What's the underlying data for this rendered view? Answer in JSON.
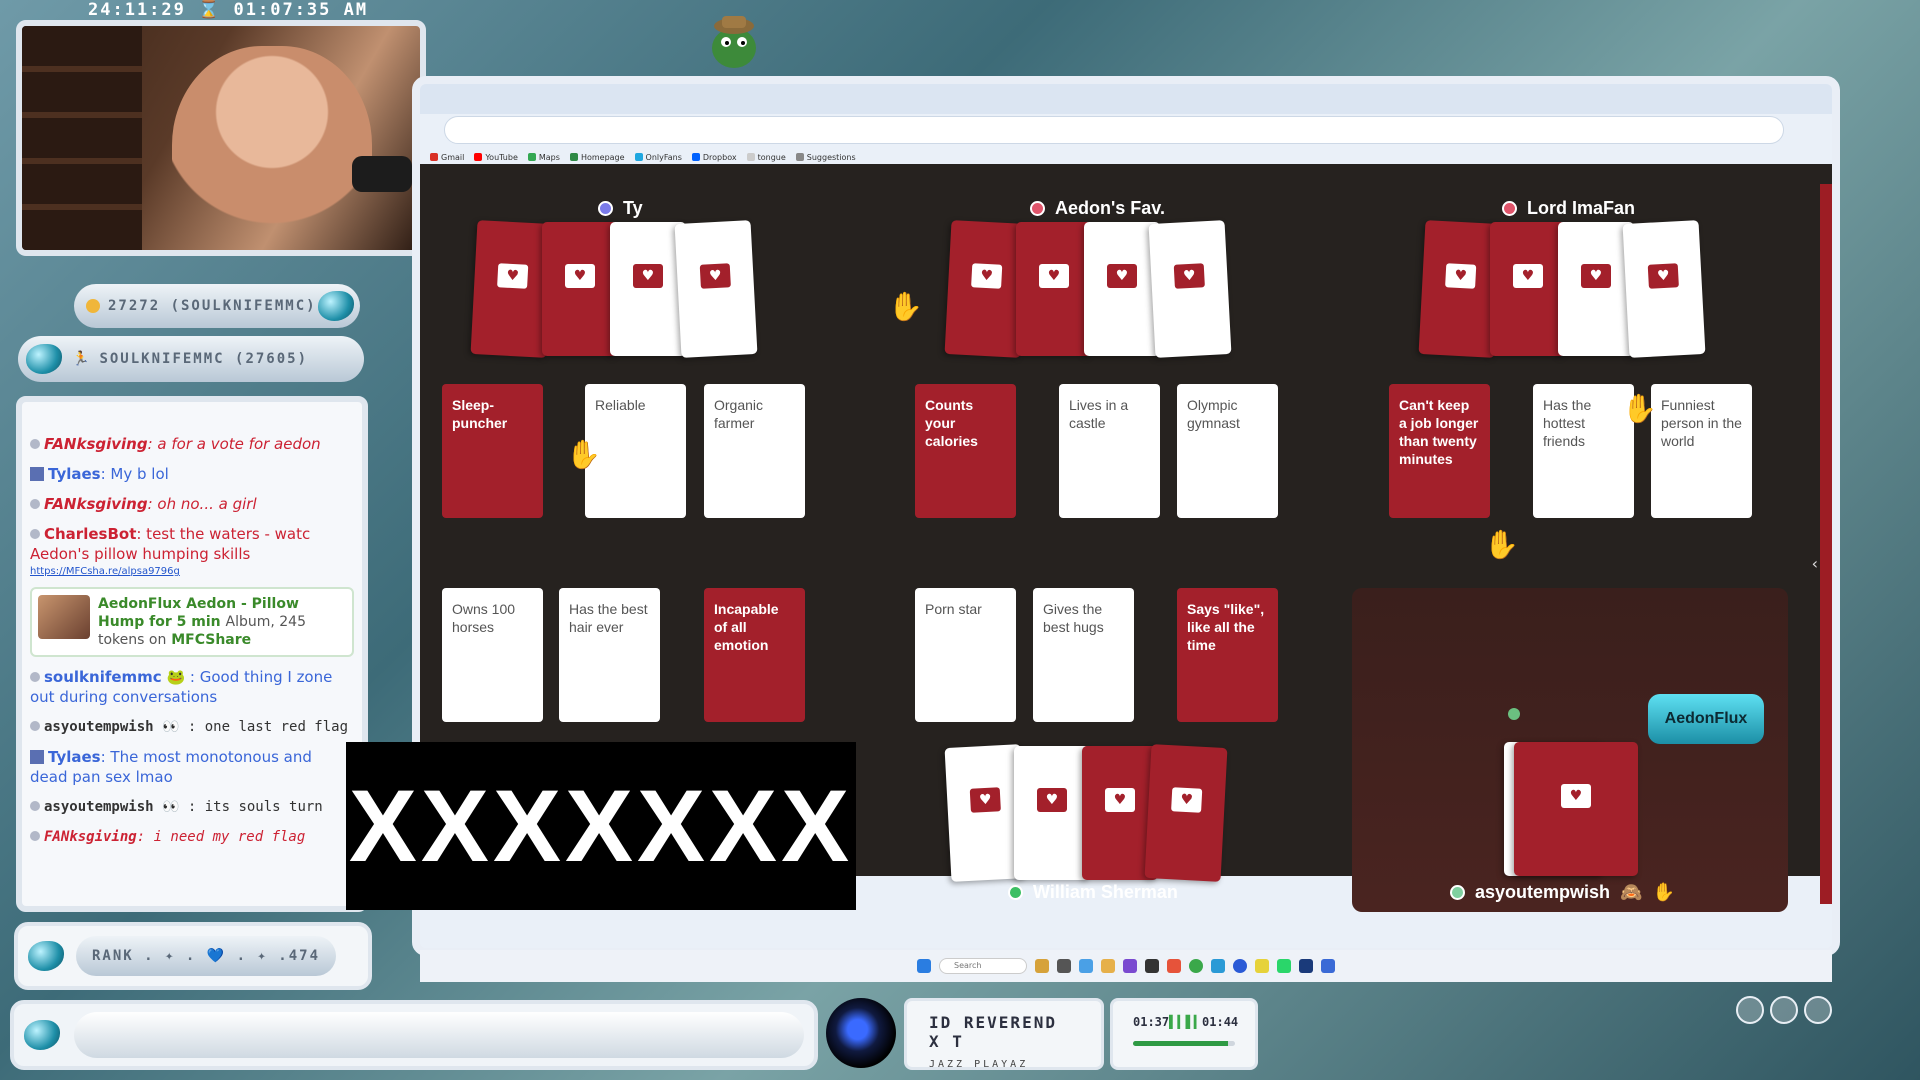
{
  "overlay": {
    "timestamp": "24:11:29 ⌛ 01:07:35 AM",
    "tip_top": "27272 (SOULKNIFEMMC)",
    "tip_top_leader": "SOULKNIFEMMC (27605)",
    "rank_text": "RANK . ✦ . 💙 . ✦ .474",
    "censor_text": "XXXXXXX",
    "logo_text": "AedonFlux"
  },
  "chat": {
    "messages": [
      {
        "user": "FANksgiving",
        "text": ": a  for  a vote for aedon",
        "color": "#cc2233"
      },
      {
        "user": "Tylaes",
        "text": ": My b lol",
        "color": "#3a66d8"
      },
      {
        "user": "FANksgiving",
        "text": ": oh no... a  girl",
        "color": "#cc2233"
      },
      {
        "user": "CharlesBot",
        "text": ": test the waters - watc Aedon's pillow humping skills",
        "color": "#cc2233"
      },
      {
        "user": "soulknifemmc",
        "text": "🐸 : Good thing I zone out during conversations",
        "color": "#3a66d8"
      },
      {
        "user": "asyoutempwish",
        "text": "👀 : one last red flag",
        "color": "#333333"
      },
      {
        "user": "Tylaes",
        "text": ": The most monotonous and dead pan sex lmao",
        "color": "#3a66d8"
      },
      {
        "user": "asyoutempwish",
        "text": "👀 : its souls turn",
        "color": "#333333"
      },
      {
        "user": "FANksgiving",
        "text": ": i need my red flag",
        "color": "#cc2233"
      }
    ],
    "link": "https://MFCsha.re/alpsa9796g",
    "mfc_card": {
      "title": "AedonFlux Aedon - Pillow Hump for 5 min",
      "meta": "Album, 245 tokens on",
      "brand": "MFCShare"
    }
  },
  "music": {
    "title": "ID REVEREND X T",
    "artist": "JAZZ PLAYAZ",
    "elapsed": "01:37",
    "total": "01:44",
    "progress": 0.93
  },
  "browser": {
    "bookmarks": [
      "Gmail",
      "YouTube",
      "Maps",
      "Homepage",
      "OnlyFans",
      "Dropbox",
      "tongue",
      "Suggestions"
    ],
    "search_placeholder": "Search"
  },
  "game": {
    "players": [
      {
        "name": "Ty",
        "color": "#7b7bea"
      },
      {
        "name": "Aedon's Fav.",
        "color": "#e0556b"
      },
      {
        "name": "Lord ImaFan",
        "color": "#e0556b"
      },
      {
        "name": "William Sherman",
        "color": "#3cbf63"
      },
      {
        "name": "asyoutempwish",
        "color": "#7fd0a0"
      }
    ],
    "cards": {
      "ty_top": [
        "Sleep-puncher",
        "Reliable",
        "Organic farmer"
      ],
      "fav_top": [
        "Counts your calories",
        "Lives in a castle",
        "Olympic gymnast"
      ],
      "lord_top": [
        "Can't keep a job longer than twenty minutes",
        "Has the hottest friends",
        "Funniest person in the world"
      ],
      "ty_bottom": [
        "Owns 100 horses",
        "Has the best hair ever",
        "Incapable of all emotion"
      ],
      "fav_bottom": [
        "Porn star",
        "Gives the best hugs",
        "Says \"like\", like all the time"
      ]
    },
    "card_kinds": {
      "ty_top": [
        "red",
        "white",
        "white"
      ],
      "fav_top": [
        "red",
        "white",
        "white"
      ],
      "lord_top": [
        "red",
        "white",
        "white"
      ],
      "ty_bottom": [
        "white",
        "white",
        "red"
      ],
      "fav_bottom": [
        "white",
        "white",
        "red"
      ]
    }
  }
}
